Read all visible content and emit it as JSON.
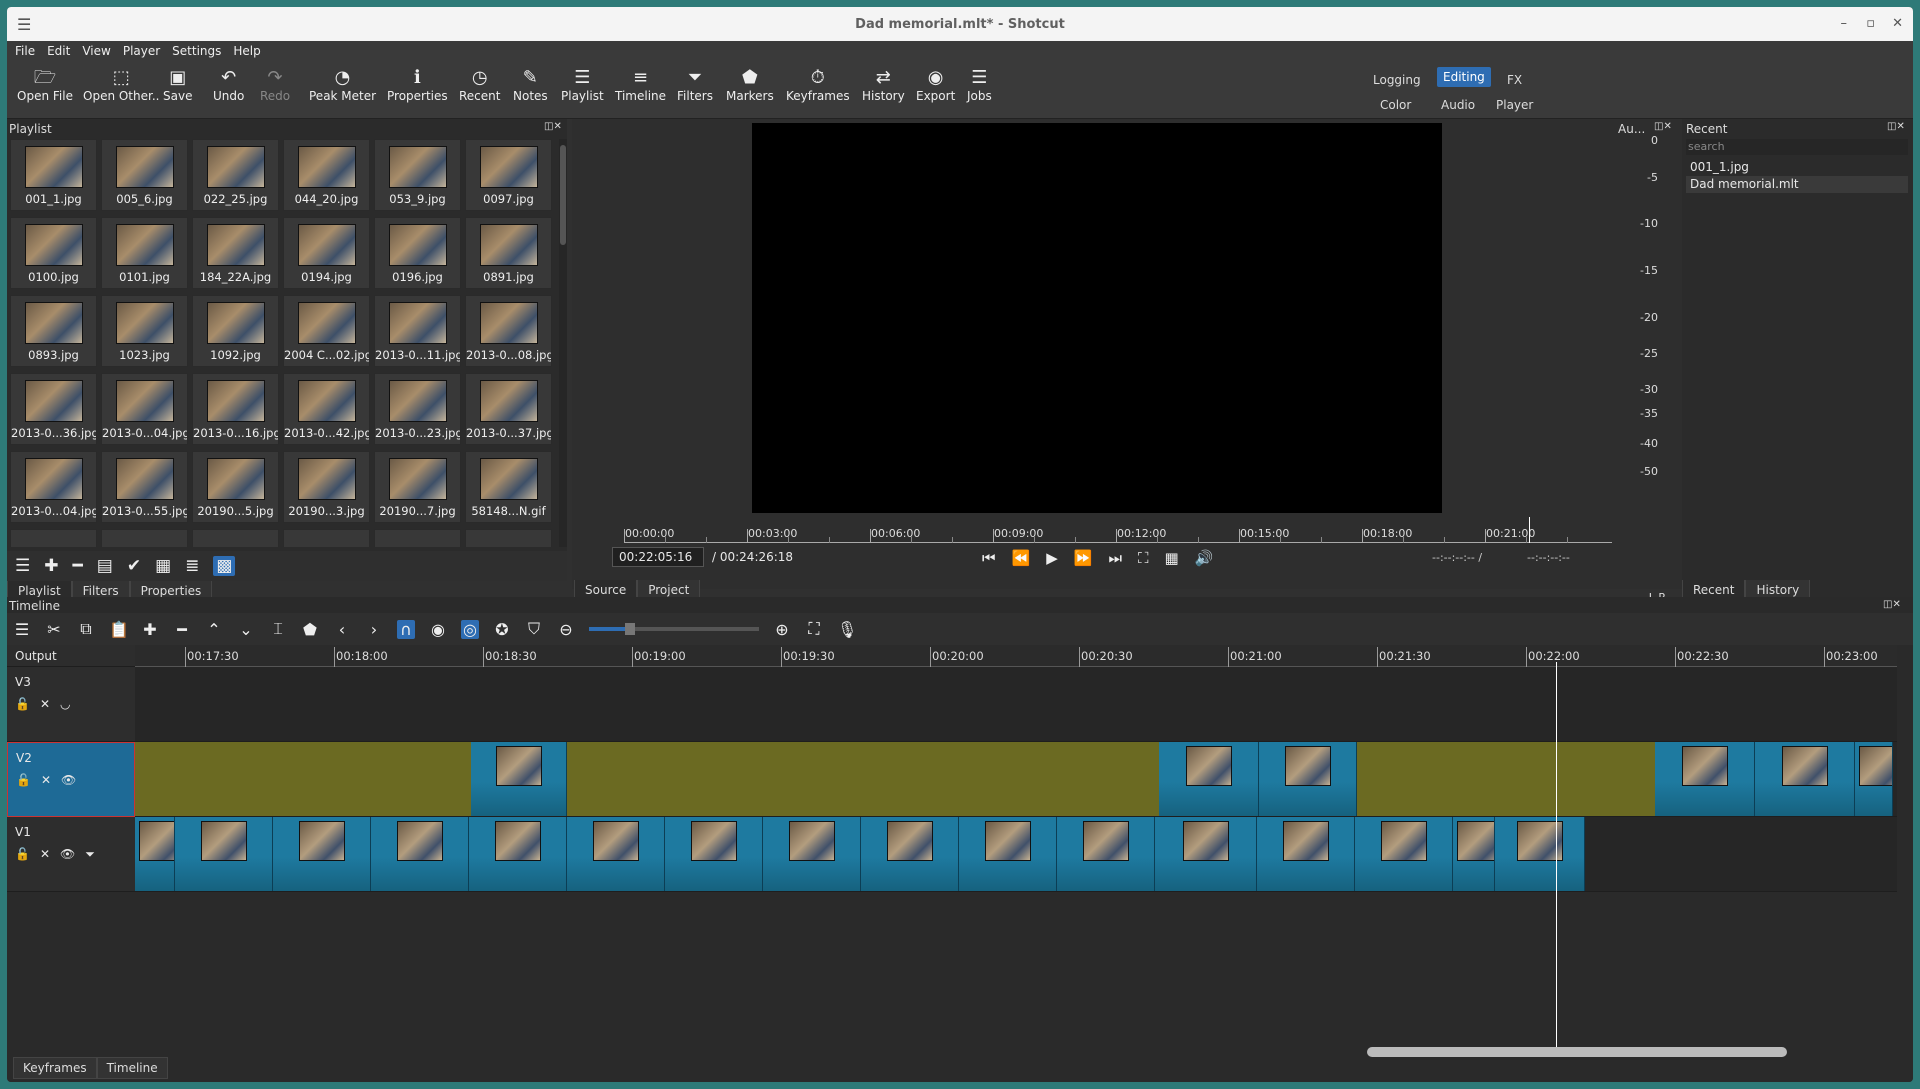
{
  "window": {
    "title": "Dad memorial.mlt* - Shotcut"
  },
  "menu": [
    "File",
    "Edit",
    "View",
    "Player",
    "Settings",
    "Help"
  ],
  "toolbar": [
    {
      "label": "Open File",
      "icon": "open-file-icon"
    },
    {
      "label": "Open Other..",
      "icon": "open-other-icon"
    },
    {
      "label": "Save",
      "icon": "save-icon"
    },
    {
      "label": "Undo",
      "icon": "undo-icon"
    },
    {
      "label": "Redo",
      "icon": "redo-icon",
      "disabled": true
    },
    {
      "label": "Peak Meter",
      "icon": "peak-meter-icon"
    },
    {
      "label": "Properties",
      "icon": "properties-icon"
    },
    {
      "label": "Recent",
      "icon": "recent-icon"
    },
    {
      "label": "Notes",
      "icon": "notes-icon"
    },
    {
      "label": "Playlist",
      "icon": "playlist-icon"
    },
    {
      "label": "Timeline",
      "icon": "timeline-icon"
    },
    {
      "label": "Filters",
      "icon": "filters-icon"
    },
    {
      "label": "Markers",
      "icon": "markers-icon"
    },
    {
      "label": "Keyframes",
      "icon": "keyframes-icon"
    },
    {
      "label": "History",
      "icon": "history-icon"
    },
    {
      "label": "Export",
      "icon": "export-icon"
    },
    {
      "label": "Jobs",
      "icon": "jobs-icon"
    }
  ],
  "layouts": {
    "logging": "Logging",
    "editing": "Editing",
    "fx": "FX",
    "color": "Color",
    "audio": "Audio",
    "player": "Player",
    "selected": "Editing"
  },
  "playlist": {
    "title": "Playlist",
    "items": [
      "001_1.jpg",
      "005_6.jpg",
      "022_25.jpg",
      "044_20.jpg",
      "053_9.jpg",
      "0097.jpg",
      "0100.jpg",
      "0101.jpg",
      "184_22A.jpg",
      "0194.jpg",
      "0196.jpg",
      "0891.jpg",
      "0893.jpg",
      "1023.jpg",
      "1092.jpg",
      "2004 C...02.jpg",
      "2013-0...11.jpg",
      "2013-0...08.jpg",
      "2013-0...36.jpg",
      "2013-0...04.jpg",
      "2013-0...16.jpg",
      "2013-0...42.jpg",
      "2013-0...23.jpg",
      "2013-0...37.jpg",
      "2013-0...04.jpg",
      "2013-0...55.jpg",
      "20190...5.jpg",
      "20190...3.jpg",
      "20190...7.jpg",
      "58148...N.gif"
    ],
    "tabs": [
      "Playlist",
      "Filters",
      "Properties"
    ]
  },
  "player": {
    "current_time": "00:22:05:16",
    "total_time": "/ 00:24:26:18",
    "ruler_labels": [
      "00:00:00",
      "00:03:00",
      "00:06:00",
      "00:09:00",
      "00:12:00",
      "00:15:00",
      "00:18:00",
      "00:21:00"
    ],
    "in_point": "--:--:--:-- /",
    "out_point": "--:--:--:--",
    "tabs": [
      "Source",
      "Project"
    ]
  },
  "audio_meter": {
    "title": "Au...",
    "labels": [
      "0",
      "-5",
      "-10",
      "-15",
      "-20",
      "-25",
      "-30",
      "-35",
      "-40",
      "-50"
    ],
    "channels": "L R"
  },
  "recent": {
    "title": "Recent",
    "search_placeholder": "search",
    "items": [
      "001_1.jpg",
      "Dad memorial.mlt"
    ],
    "tabs": [
      "Recent",
      "History"
    ]
  },
  "timeline": {
    "title": "Timeline",
    "output_label": "Output",
    "ruler_labels": [
      "00:17:30",
      "00:18:00",
      "00:18:30",
      "00:19:00",
      "00:19:30",
      "00:20:00",
      "00:20:30",
      "00:21:00",
      "00:21:30",
      "00:22:00",
      "00:22:30",
      "00:23:00"
    ],
    "tracks": [
      "V3",
      "V2",
      "V1"
    ],
    "bottom_tabs": [
      "Keyframes",
      "Timeline"
    ]
  },
  "colors": {
    "accent": "#2e6db3",
    "clip": "#1e7aa0",
    "blank": "#6b6a22"
  }
}
